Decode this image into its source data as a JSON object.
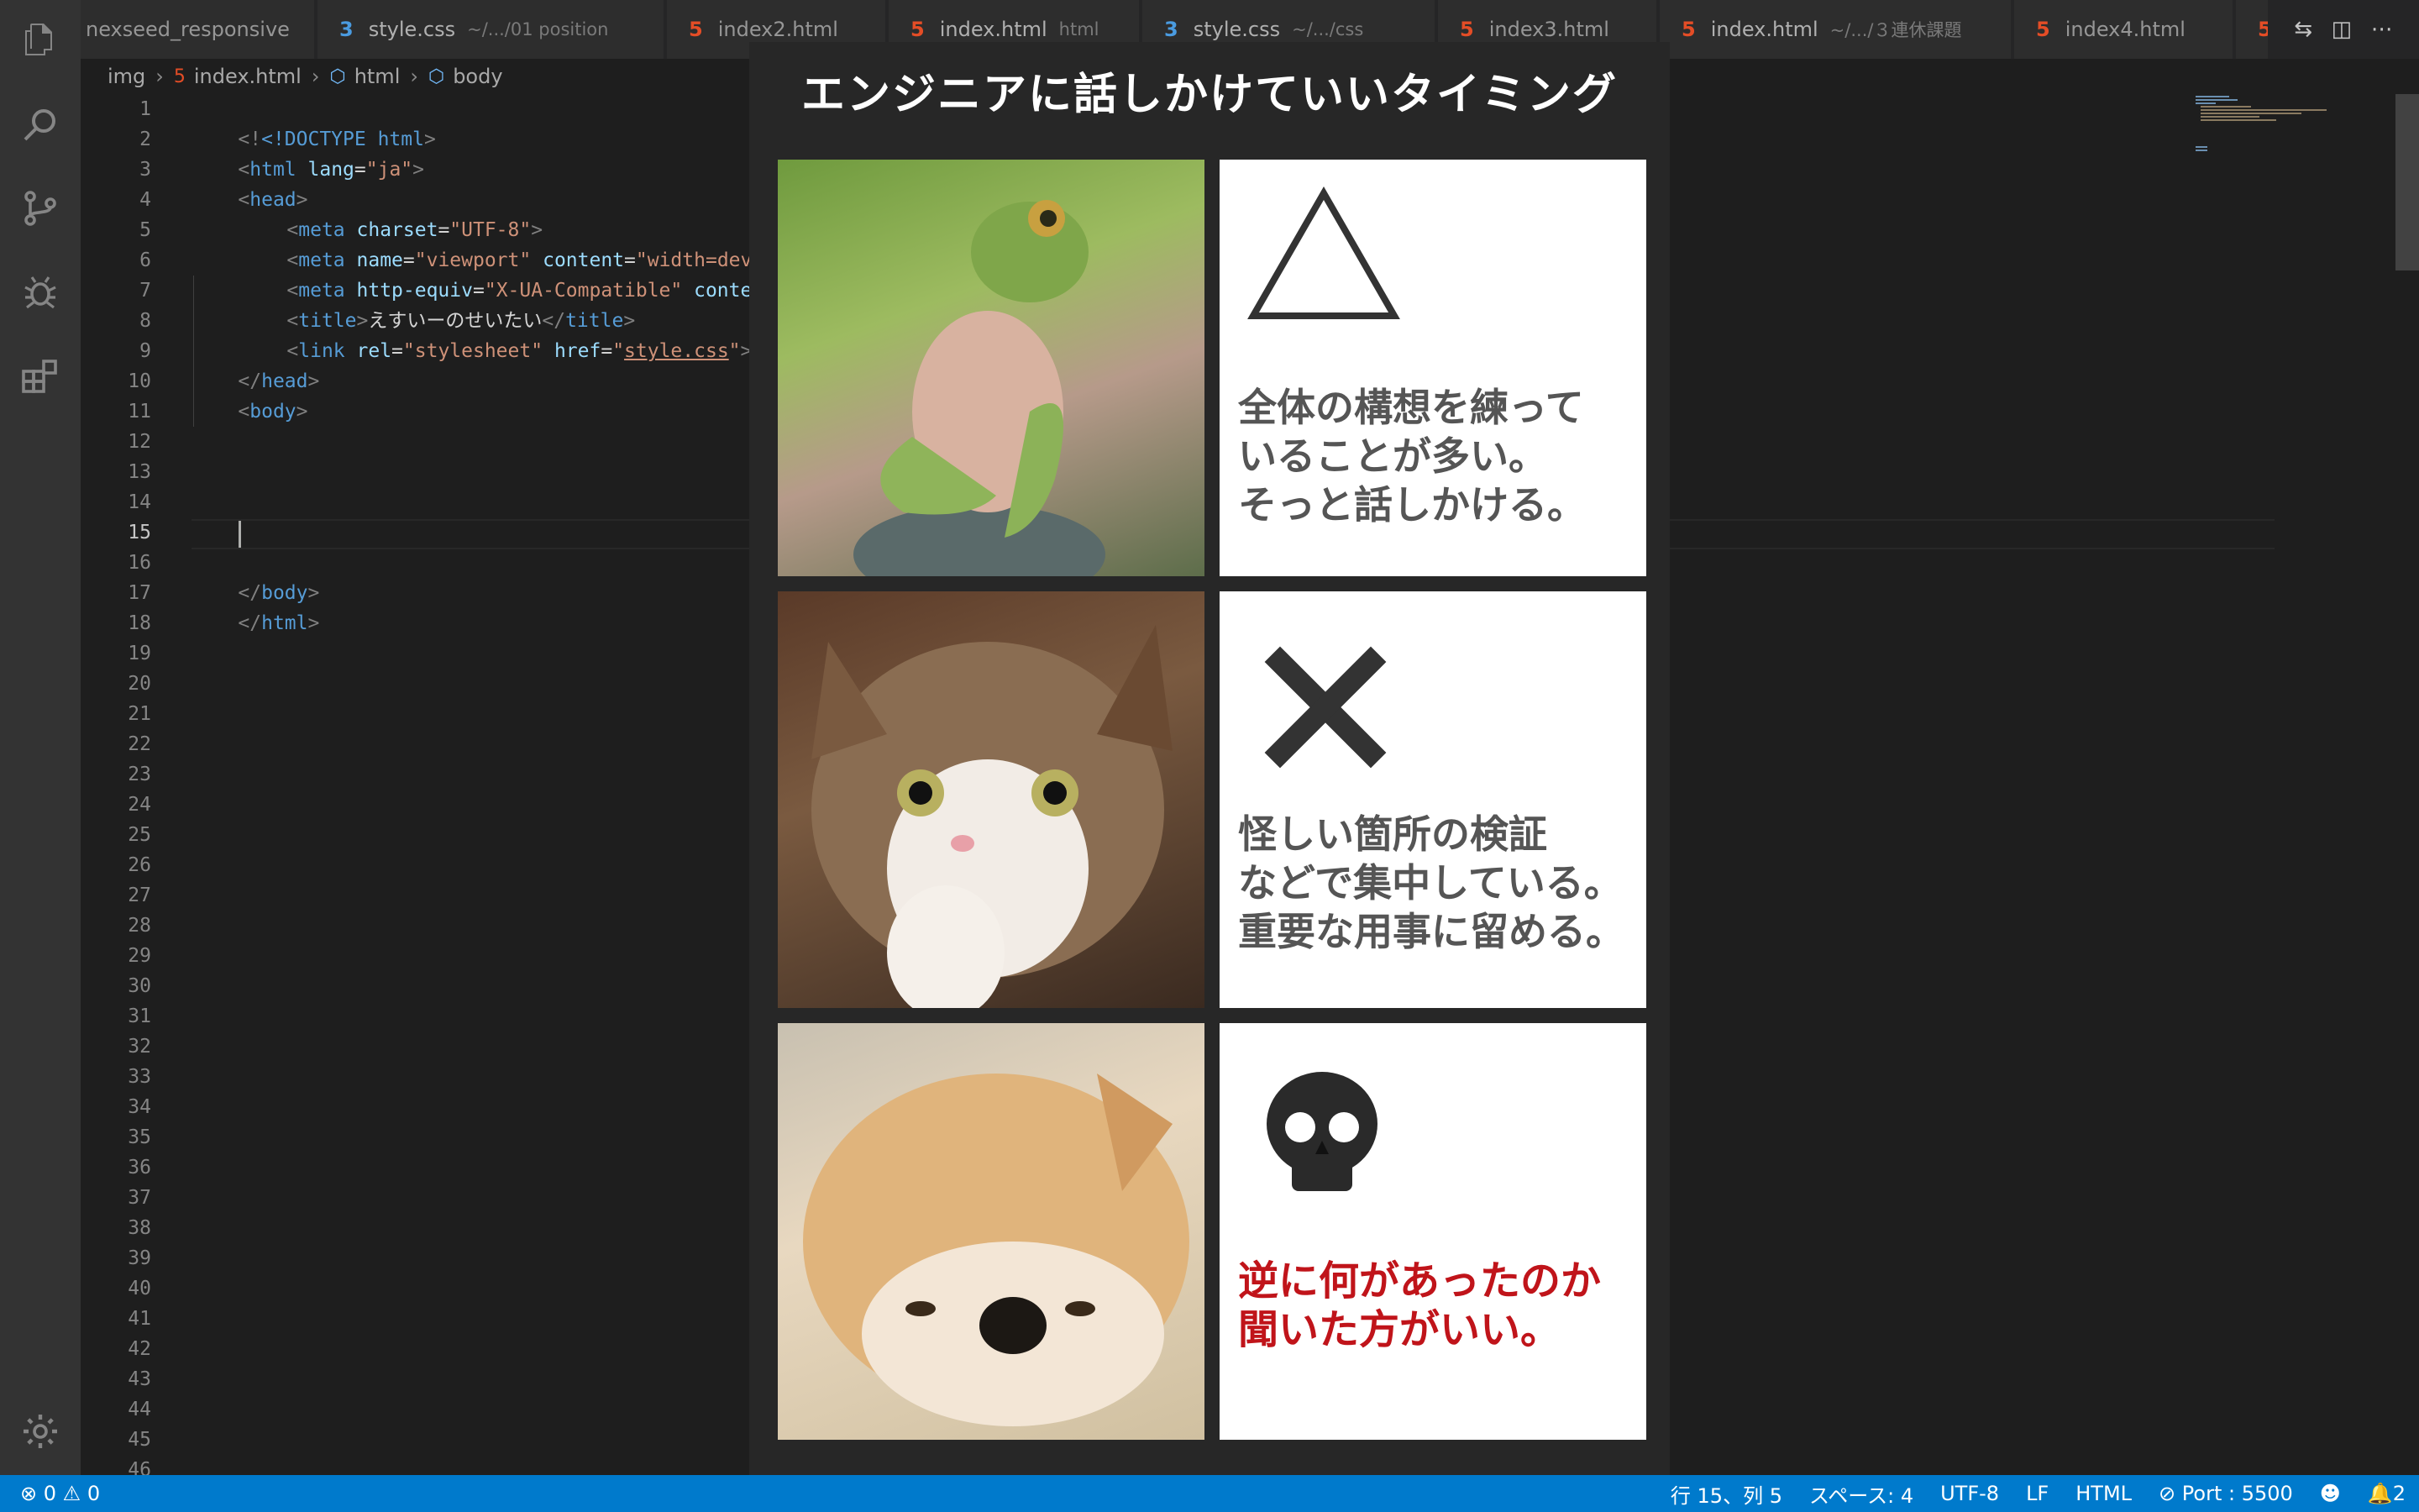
{
  "tabs": [
    {
      "label": "nexseed_responsive",
      "description": "",
      "icon": "none"
    },
    {
      "label": "style.css",
      "description": "~/.../01 position",
      "icon": "css"
    },
    {
      "label": "index2.html",
      "description": "",
      "icon": "html"
    },
    {
      "label": "index.html",
      "description": "html",
      "icon": "html"
    },
    {
      "label": "style.css",
      "description": "~/.../css",
      "icon": "css"
    },
    {
      "label": "index3.html",
      "description": "",
      "icon": "html"
    },
    {
      "label": "index.html",
      "description": "~/.../３連休課題",
      "icon": "html"
    },
    {
      "label": "index4.html",
      "description": "",
      "icon": "html"
    }
  ],
  "breadcrumb": {
    "folder": "img",
    "file": "index.html",
    "node1": "html",
    "node2": "body"
  },
  "editor": {
    "line_numbers": [
      "1",
      "2",
      "3",
      "4",
      "5",
      "6",
      "7",
      "8",
      "9",
      "10",
      "11",
      "12",
      "13",
      "14",
      "15",
      "16",
      "17",
      "18",
      "19",
      "20",
      "21",
      "22",
      "23",
      "24",
      "25",
      "26",
      "27",
      "28",
      "29",
      "30",
      "31",
      "32",
      "33",
      "34",
      "35",
      "36",
      "37",
      "38",
      "39",
      "40",
      "41",
      "42",
      "43",
      "44",
      "45",
      "46"
    ],
    "active_line": "15",
    "code": {
      "l1_tag": "<!DOCTYPE",
      "l1_val": " html",
      "l2_tag": "html",
      "l2_attr": "lang",
      "l2_val": "\"ja\"",
      "l3_tag": "head",
      "l4_tag": "meta",
      "l4_attr": "charset",
      "l4_val": "\"UTF-8\"",
      "l5_tag": "meta",
      "l5_attr1": "name",
      "l5_val1": "\"viewport\"",
      "l5_attr2": "content",
      "l5_val2": "\"width=devic",
      "l6_tag": "meta",
      "l6_attr1": "http-equiv",
      "l6_val1": "\"X-UA-Compatible\"",
      "l6_attr2": "content",
      "l7_tag": "title",
      "l7_text": "えすいーのせいたい",
      "l8_tag": "link",
      "l8_attr1": "rel",
      "l8_val1": "\"stylesheet\"",
      "l8_attr2": "href",
      "l8_val2_q": "\"",
      "l8_val2": "style.css",
      "l9_tag": "head",
      "l10_tag": "body",
      "l16_tag": "body",
      "l17_tag": "html"
    }
  },
  "meme": {
    "title": "エンジニアに話しかけていいタイミング",
    "rows": [
      {
        "animal": "frog",
        "symbol": "triangle",
        "caption": [
          "全体の構想を練って",
          "いることが多い。",
          "そっと話しかける。"
        ],
        "caption_color": "#555555"
      },
      {
        "animal": "cat",
        "symbol": "cross",
        "caption": [
          "怪しい箇所の検証",
          "などで集中している。",
          "重要な用事に留める。"
        ],
        "caption_color": "#555555"
      },
      {
        "animal": "dog",
        "symbol": "skull",
        "caption": [
          "逆に何があったのか",
          "聞いた方がいい。"
        ],
        "caption_color": "#c0141a"
      }
    ]
  },
  "statusbar": {
    "errors": "0",
    "warnings": "0",
    "position": "行 15、列 5",
    "spaces": "スペース: 4",
    "encoding": "UTF-8",
    "eol": "LF",
    "language": "HTML",
    "port": "Port : 5500",
    "notifications": "2"
  }
}
